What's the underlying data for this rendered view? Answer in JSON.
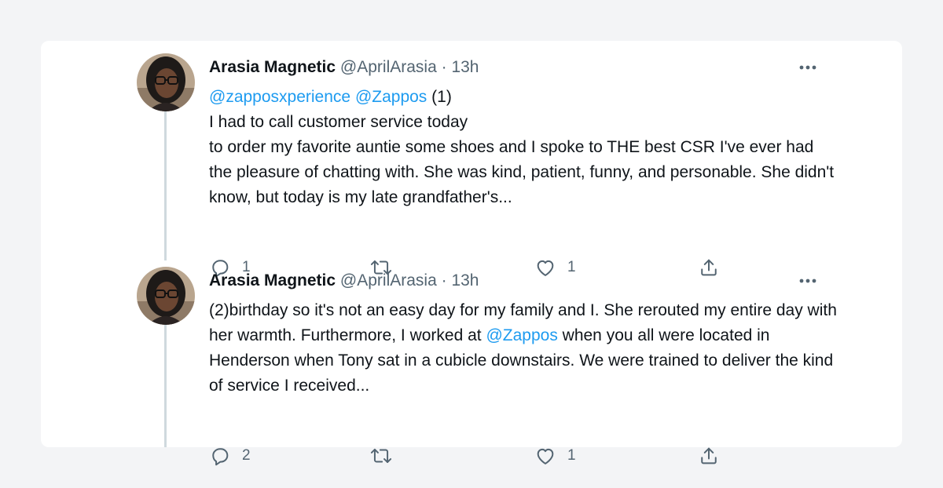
{
  "tweets": [
    {
      "name": "Arasia Magnetic",
      "handle": "@AprilArasia",
      "separator": "·",
      "time": "13h",
      "mention1": "@zapposxperience",
      "mention2": "@Zappos",
      "part": "(1)",
      "line1": "I had to call customer service today",
      "text_rest": "to order my favorite auntie some shoes and I spoke to THE best CSR I've ever had the pleasure of chatting with. She was kind, patient, funny, and personable. She didn't know, but today is my late grandfather's...",
      "reply_count": "1",
      "retweet_count": "",
      "like_count": "1"
    },
    {
      "name": "Arasia Magnetic",
      "handle": "@AprilArasia",
      "separator": "·",
      "time": "13h",
      "text_before": "(2)birthday so it's not an easy day for my family and I. She rerouted my entire day with her warmth. Furthermore,  I worked at ",
      "mention": "@Zappos",
      "text_after": " when you all were located in Henderson when Tony sat in a cubicle downstairs. We were trained to deliver the kind of service I received...",
      "reply_count": "2",
      "retweet_count": "",
      "like_count": "1"
    }
  ],
  "colors": {
    "link": "#1d9bf0",
    "secondary": "#536471",
    "thread_line": "#cfd9de",
    "background": "#f3f4f6"
  },
  "icons": [
    "more-icon",
    "reply-icon",
    "retweet-icon",
    "like-icon",
    "share-icon"
  ]
}
